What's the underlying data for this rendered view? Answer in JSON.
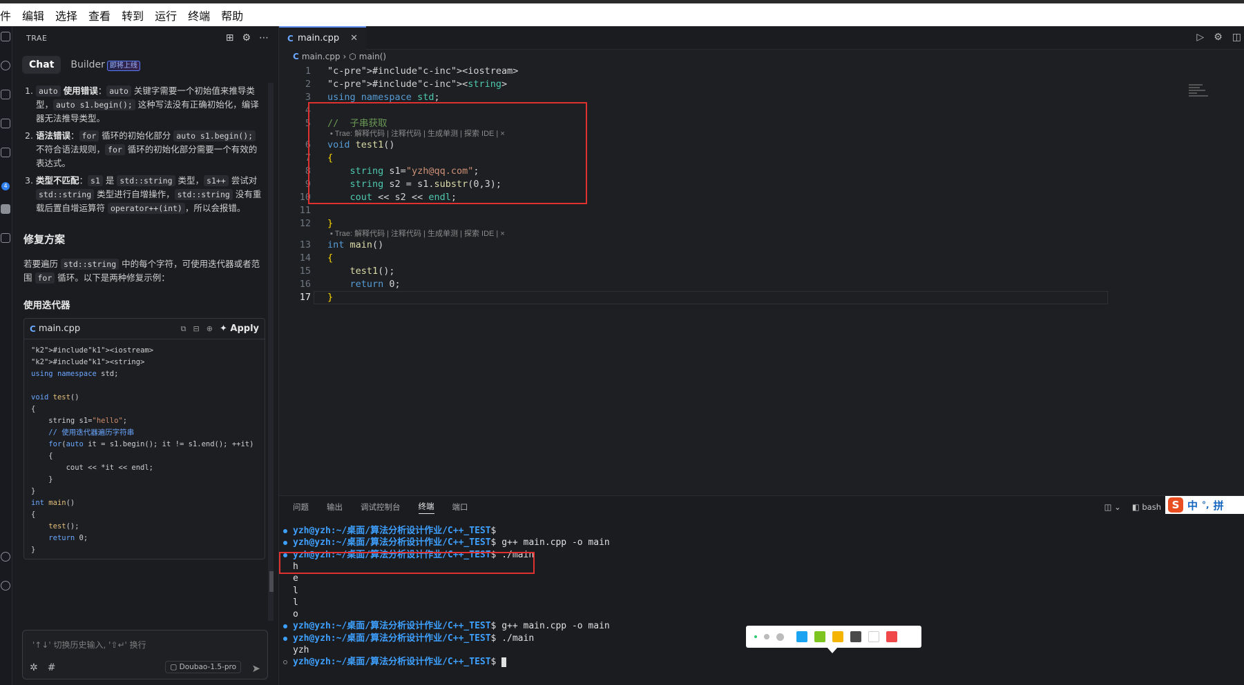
{
  "menubar": {
    "items": [
      "件",
      "编辑",
      "选择",
      "查看",
      "转到",
      "运行",
      "终端",
      "帮助"
    ]
  },
  "sidebar": {
    "title": "TRAE",
    "tabs": {
      "chat": "Chat",
      "builder": "Builder",
      "builder_badge": "即将上线"
    },
    "items": [
      {
        "num": "1.",
        "title": "使用错误",
        "code1": "auto",
        "code2": "auto",
        "t1": "关键字需要一个初始值来推导类型，",
        "code3": "auto s1.begin();",
        "t2": "这种写法没有正确初始化，编译器无法推导类型。"
      },
      {
        "num": "2.",
        "title": "语法错误",
        "code1": "for",
        "t1": "循环的初始化部分",
        "code2": "auto s1.begin();",
        "t2": "不符合语法规则，",
        "code3": "for",
        "t3": "循环的初始化部分需要一个有效的表达式。"
      },
      {
        "num": "3.",
        "title": "类型不匹配",
        "code1": "s1",
        "t1": "是",
        "code2": "std::string",
        "t2": "类型，",
        "code3": "s1++",
        "t3": "尝试对",
        "code4": "std::string",
        "t4": "类型进行自增操作，",
        "code5": "std::string",
        "t5": "没有重载后置自增运算符",
        "code6": "operator++(int)",
        "t6": "，所以会报错。"
      }
    ],
    "fix_heading": "修复方案",
    "fix_para": {
      "a": "若要遍历",
      "code1": "std::string",
      "b": "中的每个字符，可使用迭代器或者范围",
      "code2": "for",
      "c": "循环。以下是两种修复示例："
    },
    "iter_heading": "使用迭代器",
    "card": {
      "filename": "main.cpp",
      "apply": "Apply",
      "code_lines": [
        "#include<iostream>",
        "#include<string>",
        "using namespace std;",
        "",
        "void test()",
        "{",
        "    string s1=\"hello\";",
        "    // 使用迭代器遍历字符串",
        "    for(auto it = s1.begin(); it != s1.end(); ++it)",
        "    {",
        "        cout << *it << endl;",
        "    }",
        "}",
        "int main()",
        "{",
        "    test();",
        "    return 0;",
        "}"
      ]
    },
    "input_placeholder": "'↑↓' 切换历史输入, '⇧↵' 换行",
    "model": "Doubao-1.5-pro"
  },
  "editor": {
    "tab": "main.cpp",
    "breadcrumb": {
      "file": "main.cpp",
      "symbol": "main()"
    },
    "hint_text": "Trae: 解释代码 | 注释代码 | 生成单测 | 探索 IDE | ×",
    "lines": [
      "#include<iostream>",
      "#include<string>",
      "using namespace std;",
      "",
      "//  子串获取",
      "void test1()",
      "{",
      "    string s1=\"yzh@qq.com\";",
      "    string s2 = s1.substr(0,3);",
      "    cout << s2 << endl;",
      "",
      "}",
      "int main()",
      "{",
      "    test1();",
      "    return 0;",
      "}"
    ]
  },
  "panel": {
    "tabs": [
      "问题",
      "输出",
      "调试控制台",
      "终端",
      "端口"
    ],
    "active_tab": "终端",
    "shell": "bash",
    "ime": {
      "lang": "中",
      "punct": "°,",
      "mode": "拼"
    },
    "prompt_user": "yzh@yzh",
    "prompt_path": ":~/桌面/算法分析设计作业/C++_TEST",
    "terminal": [
      {
        "prompt": true,
        "cmd": ""
      },
      {
        "prompt": true,
        "cmd": " g++ main.cpp -o main"
      },
      {
        "prompt": true,
        "cmd": " ./main"
      },
      {
        "prompt": false,
        "cmd": "h"
      },
      {
        "prompt": false,
        "cmd": "e"
      },
      {
        "prompt": false,
        "cmd": "l"
      },
      {
        "prompt": false,
        "cmd": "l"
      },
      {
        "prompt": false,
        "cmd": "o"
      },
      {
        "prompt": true,
        "cmd": " g++ main.cpp -o main"
      },
      {
        "prompt": true,
        "cmd": " ./main"
      },
      {
        "prompt": false,
        "cmd": "yzh"
      },
      {
        "prompt": true,
        "cmd": " "
      }
    ]
  },
  "colorbar": {
    "colors": [
      "#1aa3f0",
      "#7dc41f",
      "#f5b400",
      "#4a4a4a",
      "#ffffff",
      "#f04848"
    ]
  }
}
